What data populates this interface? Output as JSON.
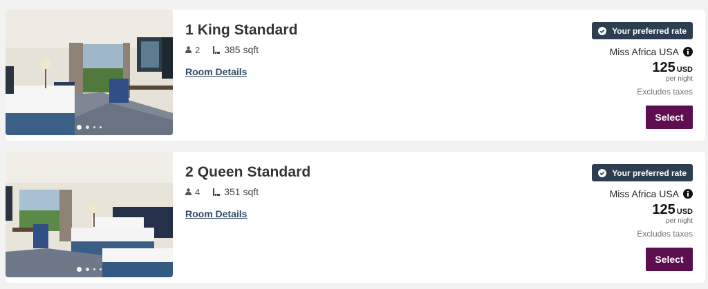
{
  "rooms": [
    {
      "title": "1 King Standard",
      "occupancy": "2",
      "area": "385 sqft",
      "details_link": "Room Details",
      "badge": "Your preferred rate",
      "rate_name": "Miss Africa USA",
      "price": "125",
      "currency": "USD",
      "per_night": "per night",
      "taxes": "Excludes taxes",
      "select_label": "Select"
    },
    {
      "title": "2 Queen Standard",
      "occupancy": "4",
      "area": "351 sqft",
      "details_link": "Room Details",
      "badge": "Your preferred rate",
      "rate_name": "Miss Africa USA",
      "price": "125",
      "currency": "USD",
      "per_night": "per night",
      "taxes": "Excludes taxes",
      "select_label": "Select"
    }
  ],
  "icons": {
    "occupancy": "person-icon",
    "area": "room-area-icon",
    "badge": "check-circle-icon",
    "rate_info": "info-icon"
  },
  "colors": {
    "badge_bg": "#2c3e50",
    "select_bg": "#5c0e4f",
    "link": "#2f4a63"
  }
}
